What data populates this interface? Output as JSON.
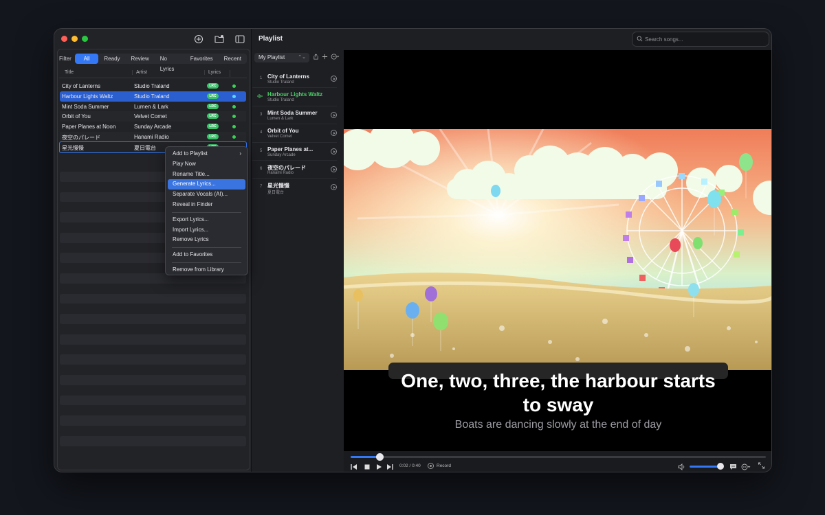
{
  "left": {
    "filter_label": "Filter",
    "filters": [
      "All",
      "Ready",
      "Review",
      "No Lyrics",
      "Favorites",
      "Recent"
    ],
    "active_filter": "All",
    "columns": [
      "Title",
      "Artist",
      "Lyrics"
    ],
    "songs": [
      {
        "title": "City of Lanterns",
        "artist": "Studio Traland",
        "lyrics": "LRC"
      },
      {
        "title": "Harbour Lights Waltz",
        "artist": "Studio Traland",
        "lyrics": "LRC"
      },
      {
        "title": "Mint Soda Summer",
        "artist": "Lumen & Lark",
        "lyrics": "LRC"
      },
      {
        "title": "Orbit of You",
        "artist": "Velvet Comet",
        "lyrics": "LRC"
      },
      {
        "title": "Paper Planes at Noon",
        "artist": "Sunday Arcade",
        "lyrics": "LRC"
      },
      {
        "title": "夜空のパレード",
        "artist": "Hanami Radio",
        "lyrics": "LRC"
      },
      {
        "title": "星光慢慢",
        "artist": "夏日電台",
        "lyrics": "LRC"
      }
    ]
  },
  "context_menu": {
    "items": [
      "Add to Playlist",
      "Play Now",
      "Rename Title...",
      "Generate Lyrics...",
      "Separate Vocals (AI)...",
      "Reveal in Finder",
      "Export Lyrics...",
      "Import Lyrics...",
      "Remove Lyrics",
      "Add to Favorites",
      "Remove from Library"
    ],
    "highlighted": "Generate Lyrics..."
  },
  "playlist": {
    "title": "Playlist",
    "selected": "My Playlist",
    "items": [
      {
        "num": "1",
        "title": "City of Lanterns",
        "artist": "Studio Traland"
      },
      {
        "num": "",
        "title": "Harbour Lights Waltz",
        "artist": "Studio Traland"
      },
      {
        "num": "3",
        "title": "Mint Soda Summer",
        "artist": "Lumen & Lark"
      },
      {
        "num": "4",
        "title": "Orbit of You",
        "artist": "Velvet Comet"
      },
      {
        "num": "5",
        "title": "Paper Planes at...",
        "artist": "Sunday Arcade"
      },
      {
        "num": "6",
        "title": "夜空のパレード",
        "artist": "Hanami Radio"
      },
      {
        "num": "7",
        "title": "星光慢慢",
        "artist": "夏日電台"
      }
    ]
  },
  "search": {
    "placeholder": "Search songs..."
  },
  "video": {
    "lyric_current_line1": "One, two, three, the harbour starts",
    "lyric_current_line2": "to sway",
    "lyric_next": "Boats are dancing slowly at the end of day"
  },
  "player": {
    "time": "0:02 / 0:40",
    "record_label": "Record",
    "progress": 0.07,
    "volume": 0.88
  },
  "colors": {
    "accent": "#3478f6",
    "playing": "#4fd06a",
    "lrc_badge": "#39c46a"
  }
}
